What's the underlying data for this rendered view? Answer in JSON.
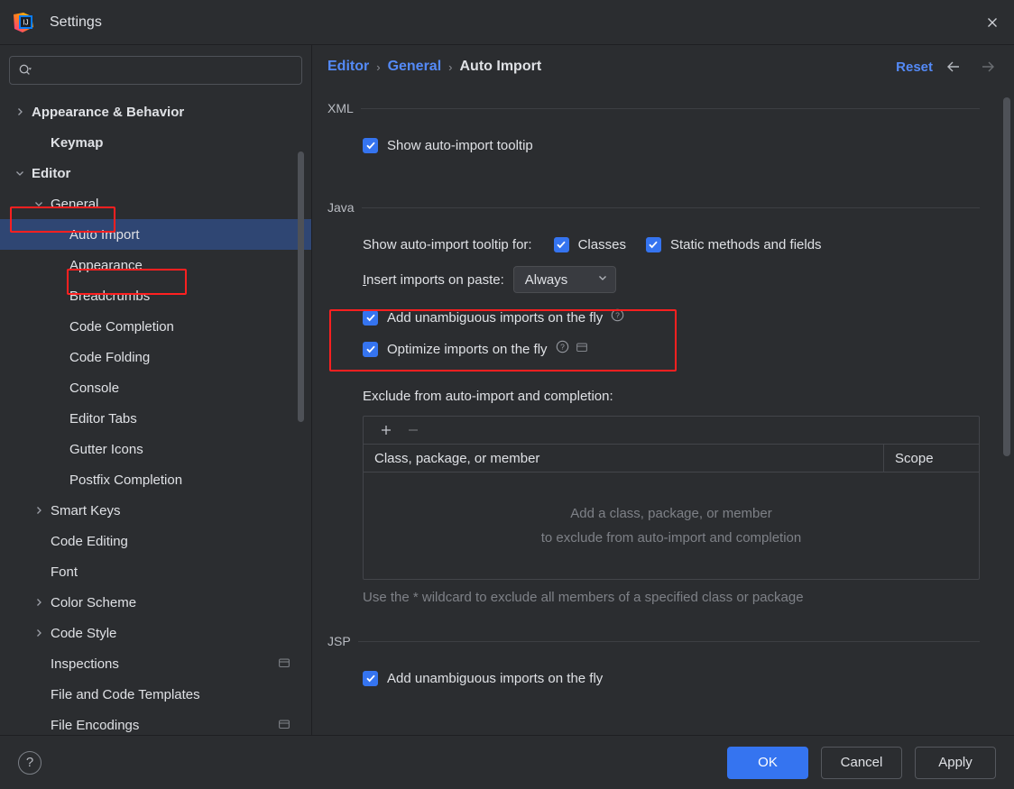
{
  "window": {
    "title": "Settings",
    "logo_icon": "intellij-idea-logo",
    "close_icon": "close-icon"
  },
  "search": {
    "value": "",
    "placeholder": "",
    "icon": "search-icon"
  },
  "sidebar": {
    "items": [
      {
        "label": "Appearance & Behavior",
        "depth": 0,
        "arrow": "chevron-right",
        "bold": true,
        "selected": false,
        "badge": ""
      },
      {
        "label": "Keymap",
        "depth": 1,
        "arrow": "",
        "bold": true,
        "selected": false,
        "badge": ""
      },
      {
        "label": "Editor",
        "depth": 0,
        "arrow": "chevron-down",
        "bold": true,
        "selected": false,
        "badge": ""
      },
      {
        "label": "General",
        "depth": 1,
        "arrow": "chevron-down",
        "bold": false,
        "selected": false,
        "badge": ""
      },
      {
        "label": "Auto Import",
        "depth": 2,
        "arrow": "",
        "bold": false,
        "selected": true,
        "badge": ""
      },
      {
        "label": "Appearance",
        "depth": 2,
        "arrow": "",
        "bold": false,
        "selected": false,
        "badge": ""
      },
      {
        "label": "Breadcrumbs",
        "depth": 2,
        "arrow": "",
        "bold": false,
        "selected": false,
        "badge": ""
      },
      {
        "label": "Code Completion",
        "depth": 2,
        "arrow": "",
        "bold": false,
        "selected": false,
        "badge": ""
      },
      {
        "label": "Code Folding",
        "depth": 2,
        "arrow": "",
        "bold": false,
        "selected": false,
        "badge": ""
      },
      {
        "label": "Console",
        "depth": 2,
        "arrow": "",
        "bold": false,
        "selected": false,
        "badge": ""
      },
      {
        "label": "Editor Tabs",
        "depth": 2,
        "arrow": "",
        "bold": false,
        "selected": false,
        "badge": ""
      },
      {
        "label": "Gutter Icons",
        "depth": 2,
        "arrow": "",
        "bold": false,
        "selected": false,
        "badge": ""
      },
      {
        "label": "Postfix Completion",
        "depth": 2,
        "arrow": "",
        "bold": false,
        "selected": false,
        "badge": ""
      },
      {
        "label": "Smart Keys",
        "depth": 1,
        "arrow": "chevron-right",
        "bold": false,
        "selected": false,
        "badge": ""
      },
      {
        "label": "Code Editing",
        "depth": 1,
        "arrow": "",
        "bold": false,
        "selected": false,
        "badge": ""
      },
      {
        "label": "Font",
        "depth": 1,
        "arrow": "",
        "bold": false,
        "selected": false,
        "badge": ""
      },
      {
        "label": "Color Scheme",
        "depth": 1,
        "arrow": "chevron-right",
        "bold": false,
        "selected": false,
        "badge": ""
      },
      {
        "label": "Code Style",
        "depth": 1,
        "arrow": "chevron-right",
        "bold": false,
        "selected": false,
        "badge": ""
      },
      {
        "label": "Inspections",
        "depth": 1,
        "arrow": "",
        "bold": false,
        "selected": false,
        "badge": "project-scope-icon"
      },
      {
        "label": "File and Code Templates",
        "depth": 1,
        "arrow": "",
        "bold": false,
        "selected": false,
        "badge": ""
      },
      {
        "label": "File Encodings",
        "depth": 1,
        "arrow": "",
        "bold": false,
        "selected": false,
        "badge": "project-scope-icon"
      }
    ]
  },
  "header": {
    "breadcrumb": [
      "Editor",
      "General",
      "Auto Import"
    ],
    "separator": "›",
    "reset_label": "Reset",
    "back_icon": "arrow-left-icon",
    "forward_icon": "arrow-right-icon"
  },
  "sections": {
    "xml": {
      "title": "XML",
      "show_tooltip_label": "Show auto-import tooltip",
      "show_tooltip_checked": true
    },
    "java": {
      "title": "Java",
      "tooltip_for_label": "Show auto-import tooltip for:",
      "classes_label": "Classes",
      "classes_checked": true,
      "static_label": "Static methods and fields",
      "static_checked": true,
      "insert_label_prefix": "I",
      "insert_label_rest": "nsert imports on paste:",
      "insert_value": "Always",
      "add_unambiguous_label": "Add unambiguous imports on the fly",
      "add_unambiguous_checked": true,
      "optimize_label": "Optimize imports on the fly",
      "optimize_checked": true,
      "exclude_label": "Exclude from auto-import and completion:",
      "add_button_icon": "plus-icon",
      "remove_button_icon": "minus-icon",
      "table_columns": [
        "Class, package, or member",
        "Scope"
      ],
      "table_rows": [],
      "empty_line1": "Add a class, package, or member",
      "empty_line2": "to exclude from auto-import and completion",
      "hint": "Use the * wildcard to exclude all members of a specified class or package"
    },
    "jsp": {
      "title": "JSP",
      "add_unambiguous_label": "Add unambiguous imports on the fly",
      "add_unambiguous_checked": true
    }
  },
  "footer": {
    "help_icon": "help-icon",
    "ok_label": "OK",
    "cancel_label": "Cancel",
    "apply_label": "Apply"
  },
  "colors": {
    "accent": "#3574f0",
    "link": "#548af7",
    "selection": "#2f4673",
    "highlight": "#ff2020",
    "background": "#2b2d30"
  }
}
